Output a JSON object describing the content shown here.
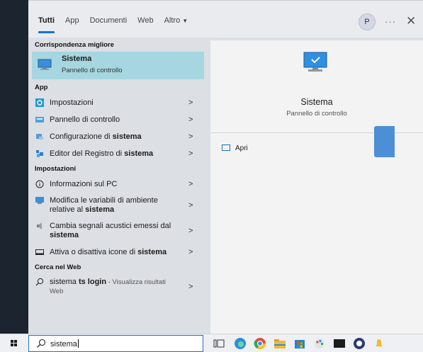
{
  "tabs": [
    {
      "label": "Tutti"
    },
    {
      "label": "App"
    },
    {
      "label": "Documenti"
    },
    {
      "label": "Web"
    },
    {
      "label": "Altro"
    }
  ],
  "header": {
    "avatar_letter": "P",
    "more": "···",
    "close": "✕"
  },
  "best_match": {
    "section": "Corrispondenza migliore",
    "title": "Sistema",
    "subtitle": "Pannello di controllo"
  },
  "app_section": "App",
  "apps": [
    {
      "pre": "Impostazioni",
      "bold": "",
      "post": "",
      "icon": "settings-icon"
    },
    {
      "pre": "Pannello di controllo",
      "bold": "",
      "post": "",
      "icon": "control-panel-icon"
    },
    {
      "pre": "Configurazione di ",
      "bold": "sistema",
      "post": "",
      "icon": "msconfig-icon"
    },
    {
      "pre": "Editor del Registro di ",
      "bold": "sistema",
      "post": "",
      "icon": "regedit-icon"
    }
  ],
  "settings_section": "Impostazioni",
  "settings": [
    {
      "line1": "Informazioni sul PC",
      "line2_pre": "",
      "line2_bold": ""
    },
    {
      "line1": "Modifica le variabili di ambiente",
      "line2_pre": "relative al ",
      "line2_bold": "sistema"
    },
    {
      "line1": "Cambia segnali acustici emessi dal",
      "line2_pre": "",
      "line2_bold": "sistema"
    },
    {
      "line1": "Attiva o disattiva icone di ",
      "line1_bold": "sistema"
    }
  ],
  "web_section": "Cerca nel Web",
  "web": {
    "pre": "sistema ",
    "bold": "ts login",
    "suffix": " - Visualizza risultati",
    "line2": "Web"
  },
  "preview": {
    "title": "Sistema",
    "subtitle": "Pannello di controllo",
    "open_label": "Apri"
  },
  "search": {
    "value": "sistema"
  },
  "arrow": ">"
}
